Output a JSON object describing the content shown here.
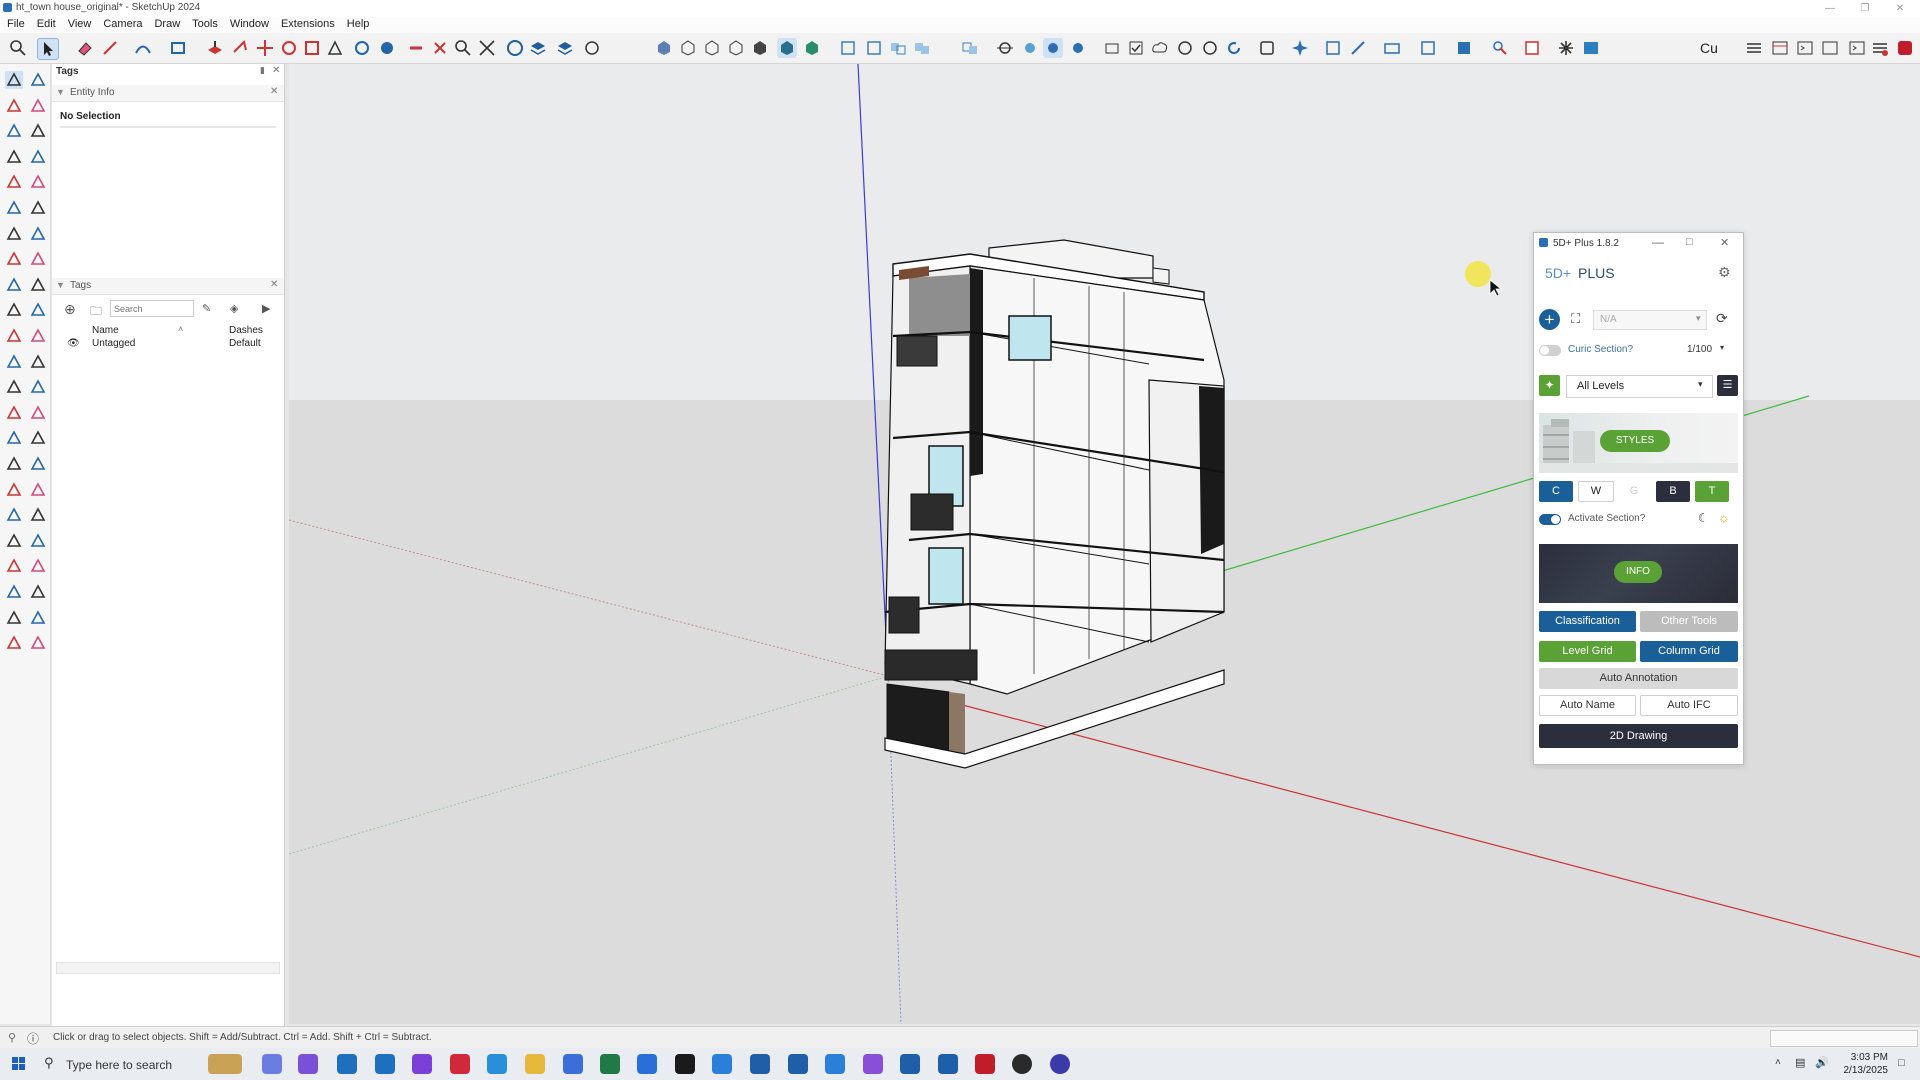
{
  "window": {
    "title": "ht_town house_original* - SketchUp 2024"
  },
  "menu": [
    "File",
    "Edit",
    "View",
    "Camera",
    "Draw",
    "Tools",
    "Window",
    "Extensions",
    "Help"
  ],
  "toolbar": {
    "right_text": "Cu"
  },
  "tray": {
    "title": "Tags",
    "entity_info": {
      "title": "Entity Info",
      "selection": "No Selection"
    },
    "tags_panel": {
      "title": "Tags",
      "search_placeholder": "Search",
      "col_name": "Name",
      "col_dashes": "Dashes",
      "rows": [
        {
          "name": "Untagged",
          "dashes": "Default"
        }
      ]
    }
  },
  "plus_panel": {
    "window_title": "5D+ Plus 1.8.2",
    "brand_prefix": "5D+",
    "brand_name": "PLUS",
    "dropdown_value": "N/A",
    "curic_section_label": "Curic Section?",
    "scale": "1/100",
    "levels_value": "All Levels",
    "styles_label": "STYLES",
    "letters": [
      "C",
      "W",
      "G",
      "B",
      "T"
    ],
    "activate_section_label": "Activate Section?",
    "info_label": "INFO",
    "buttons": {
      "classification": "Classification",
      "other_tools": "Other Tools",
      "level_grid": "Level Grid",
      "column_grid": "Column Grid",
      "auto_annotation": "Auto Annotation",
      "auto_name": "Auto Name",
      "auto_ifc": "Auto IFC",
      "drawing_2d": "2D Drawing"
    },
    "colors": {
      "blue": "#1b5f98",
      "green": "#5ba236",
      "dark": "#2a2e3d",
      "gray": "#bcbcbc"
    }
  },
  "status": {
    "hint": "Click or drag to select objects. Shift = Add/Subtract. Ctrl = Add. Shift + Ctrl = Subtract."
  },
  "taskbar": {
    "search_placeholder": "Type here to search",
    "time": "3:03 PM",
    "date": "2/13/2025"
  }
}
